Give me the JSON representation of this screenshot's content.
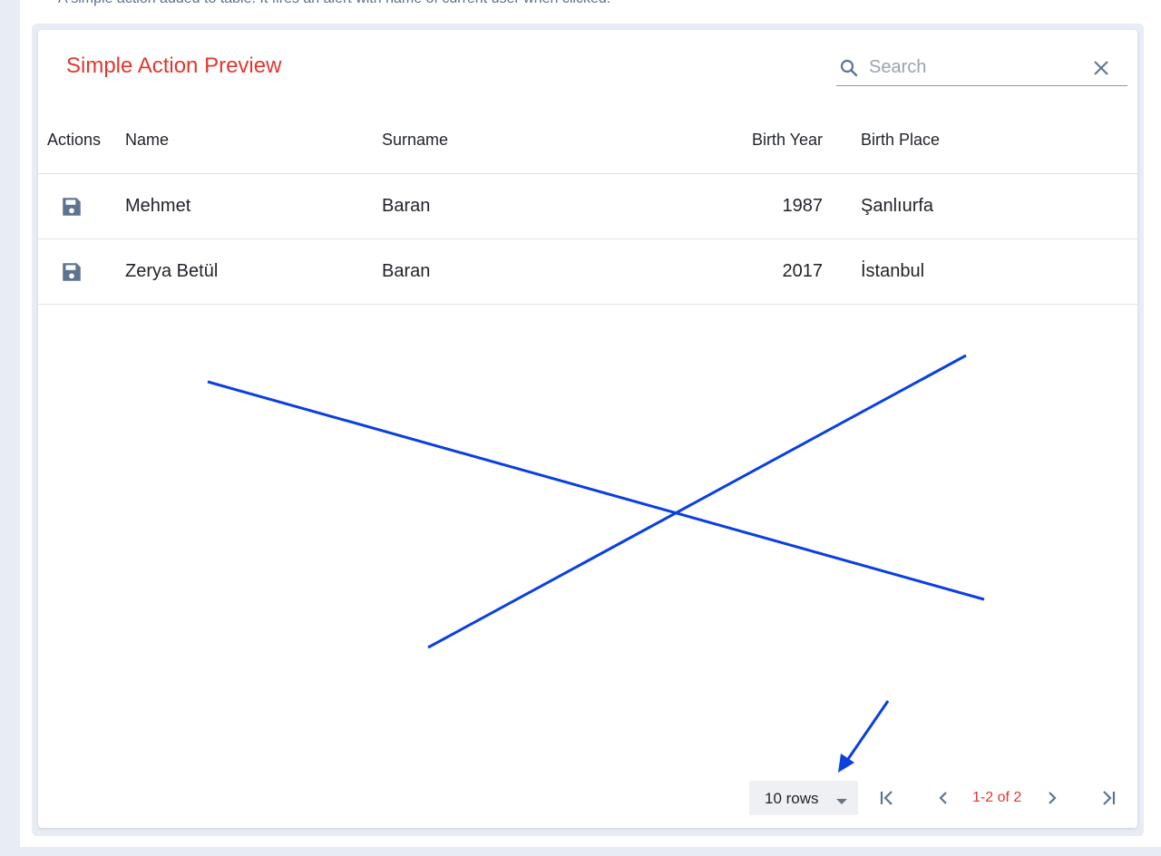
{
  "description": "A simple action added to table. It fires an alert with name of current user when clicked.",
  "title": "Simple Action Preview",
  "search": {
    "placeholder": "Search",
    "icon": "search-icon",
    "clear_icon": "close-icon"
  },
  "table": {
    "headers": [
      "Actions",
      "Name",
      "Surname",
      "Birth Year",
      "Birth Place"
    ],
    "rows": [
      {
        "action_icon": "save-icon",
        "name": "Mehmet",
        "surname": "Baran",
        "birth_year": "1987",
        "birth_place": "Şanlıurfa"
      },
      {
        "action_icon": "save-icon",
        "name": "Zerya Betül",
        "surname": "Baran",
        "birth_year": "2017",
        "birth_place": "İstanbul"
      }
    ]
  },
  "pagination": {
    "rows_per_page": "10 rows",
    "range": "1-2 of 2",
    "icons": [
      "first-page-icon",
      "prev-page-icon",
      "next-page-icon",
      "last-page-icon"
    ]
  },
  "colors": {
    "title": "#e0382f",
    "annotation": "#0a3fe0",
    "icon": "#5d7491"
  }
}
